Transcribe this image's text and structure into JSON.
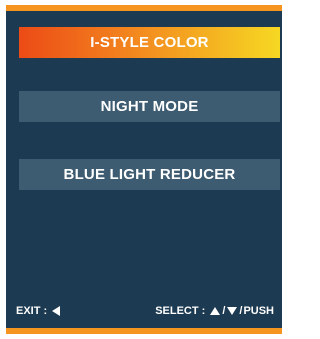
{
  "menu": {
    "items": [
      {
        "label": "I-STYLE COLOR",
        "selected": true
      },
      {
        "label": "NIGHT MODE",
        "selected": false
      },
      {
        "label": "BLUE LIGHT REDUCER",
        "selected": false
      }
    ]
  },
  "footer": {
    "exit_label": "EXIT :",
    "exit_icon": "left-arrow-icon",
    "select_label": "SELECT :",
    "select_icons": [
      "up-arrow-icon",
      "down-arrow-icon"
    ],
    "separator": "/",
    "push_label": "PUSH"
  },
  "colors": {
    "panel": "#1c3a52",
    "accent": "#f5941f",
    "item_bg": "#3e5c71",
    "selected_gradient": [
      "#ec4b16",
      "#f3891f",
      "#f6d823"
    ]
  }
}
